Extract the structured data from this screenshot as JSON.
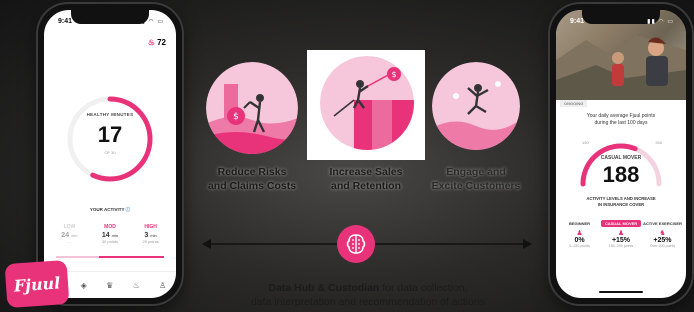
{
  "brand": {
    "logo_text": "Fjuul",
    "accent": "#e8337a"
  },
  "left_phone": {
    "time": "9:41",
    "streak_value": "72",
    "ring": {
      "label_top": "HEALTHY MINUTES",
      "value": "17",
      "label_bottom": "OF 30",
      "fraction": 0.57
    },
    "activity_title": "YOUR ACTIVITY",
    "levels": [
      {
        "name": "LOW",
        "minutes": "24",
        "unit": "min",
        "points": "—"
      },
      {
        "name": "MOD",
        "minutes": "14",
        "unit": "min",
        "points": "30 points"
      },
      {
        "name": "HIGH",
        "minutes": "3",
        "unit": "min",
        "points": "20 points"
      }
    ]
  },
  "center": {
    "cards": [
      {
        "caption_1": "Reduce Risks",
        "caption_2": "and Claims Costs"
      },
      {
        "caption_1": "Increase Sales",
        "caption_2": "and Retention"
      },
      {
        "caption_1": "Engage and",
        "caption_2": "Excite Customers"
      }
    ],
    "footer_bold": "Data Hub & Custodian",
    "footer_rest": " for data collection,",
    "footer_line2": "data interpretation and recommendation of actions"
  },
  "right_phone": {
    "time": "9:41",
    "tab": "ONGOING",
    "intro_1": "Your daily average Fjuul points",
    "intro_2": "during the last 100 days",
    "gauge": {
      "left_tick": "150",
      "right_tick": "250",
      "level": "CASUAL MOVER",
      "value": "188",
      "fraction": 0.62
    },
    "levels_title_1": "ACTIVITY LEVELS AND INCREASE",
    "levels_title_2": "IN INSURANCE COVER",
    "levels": [
      {
        "name": "BEGINNER",
        "pct": "0%",
        "range": "0–150 points"
      },
      {
        "name": "CASUAL MOVER",
        "pct": "+15%",
        "range": "150–200 points"
      },
      {
        "name": "ACTIVE EXERCISER",
        "pct": "+25%",
        "range": "Over 200 points"
      }
    ]
  }
}
